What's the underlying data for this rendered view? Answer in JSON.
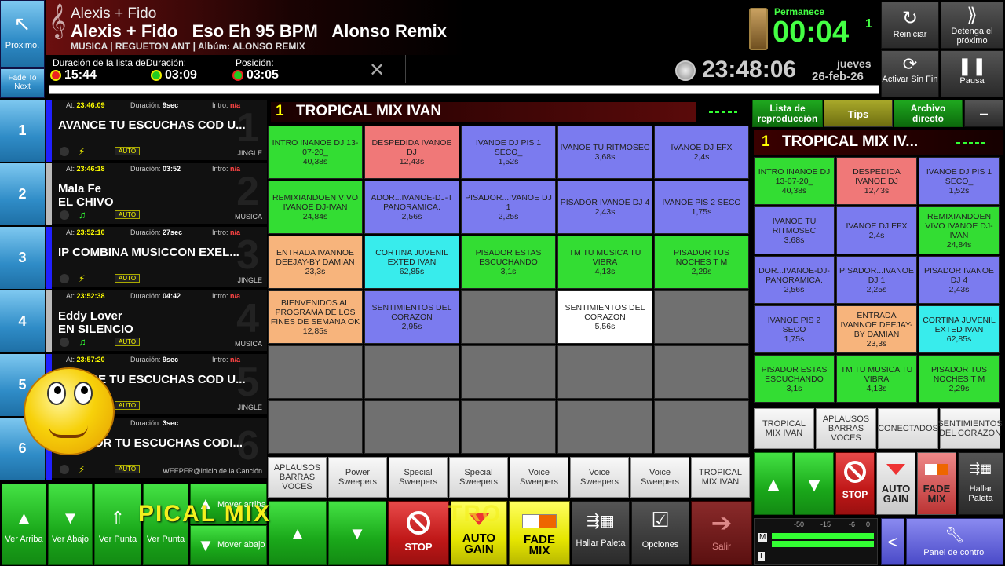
{
  "header": {
    "artist": "Alexis + Fido",
    "song_line": "Alexis + Fido   Eso Eh 95 BPM   Alonso Remix",
    "subtitle": "MUSICA | REGUETON ANT | Albúm: ALONSO REMIX",
    "next_label": "Próximo.",
    "fade_label": "Fade To Next",
    "list_duration_label": "Duración de la lista deDuración:",
    "list_duration_value": "15:44",
    "duration_value": "03:09",
    "position_label": "Posición:",
    "position_value": "03:05",
    "remain_label": "Permanece",
    "remain_value": "00:04",
    "remain_frac": "1",
    "clock": "23:48:06",
    "day": "jueves",
    "date": "26-feb-26",
    "restart_label": "Reiniciar",
    "stop_next_label": "Detenga el próximo",
    "activate_loop_label": "Activar Sin Fin",
    "pause_label": "Pausa"
  },
  "playlist": [
    {
      "num": "1",
      "at_label": "At:",
      "at": "23:46:09",
      "dur_label": "Duración:",
      "dur": "9sec",
      "intro_label": "Intro:",
      "intro": "n/a",
      "title": "AVANCE TU ESCUCHAS COD U...",
      "title2": "",
      "type": "JINGLE",
      "icon": "bolt-icon"
    },
    {
      "num": "2",
      "at_label": "At:",
      "at": "23:46:18",
      "dur_label": "Duración:",
      "dur": "03:52",
      "intro_label": "Intro:",
      "intro": "n/a",
      "title": "Mala Fe",
      "title2": "EL CHIVO",
      "type": "MUSICA",
      "icon": "music-note-icon"
    },
    {
      "num": "3",
      "at_label": "At:",
      "at": "23:52:10",
      "dur_label": "Duración:",
      "dur": "27sec",
      "intro_label": "Intro:",
      "intro": "n/a",
      "title": "IP COMBINA MUSICCON EXEL...",
      "title2": "",
      "type": "JINGLE",
      "icon": "bolt-icon"
    },
    {
      "num": "4",
      "at_label": "At:",
      "at": "23:52:38",
      "dur_label": "Duración:",
      "dur": "04:42",
      "intro_label": "Intro:",
      "intro": "n/a",
      "title": "Eddy Lover",
      "title2": "EN SILENCIO",
      "type": "MUSICA",
      "icon": "music-note-icon"
    },
    {
      "num": "5",
      "at_label": "At:",
      "at": "23:57:20",
      "dur_label": "Duración:",
      "dur": "9sec",
      "intro_label": "Intro:",
      "intro": "n/a",
      "title": "AVANCE TU ESCUCHAS COD U...",
      "title2": "",
      "type": "JINGLE",
      "icon": "bolt-icon"
    },
    {
      "num": "6",
      "at_label": "",
      "at": "",
      "dur_label": "Duración:",
      "dur": "3sec",
      "intro_label": "",
      "intro": "",
      "title": "PISADOR TU ESCUCHAS CODI...",
      "title2": "",
      "type": "WEEPER@Inicio de la Canción",
      "icon": "bolt-icon"
    }
  ],
  "auto_label": "AUTO",
  "center": {
    "number": "1",
    "title": "TROPICAL MIX IVAN",
    "cells": [
      {
        "text": "INTRO INANOE DJ 13-07-20_",
        "time": "40,38s",
        "color": "green"
      },
      {
        "text": "DESPEDIDA IVANOE DJ",
        "time": "12,43s",
        "color": "red"
      },
      {
        "text": "IVANOE DJ PIS 1 SECO_",
        "time": "1,52s",
        "color": "purple"
      },
      {
        "text": "IVANOE TU RITMOSEC",
        "time": "3,68s",
        "color": "purple"
      },
      {
        "text": "IVANOE DJ EFX",
        "time": "2,4s",
        "color": "purple"
      },
      {
        "text": "REMIXIANDOEN VIVO IVANOE DJ-IVAN",
        "time": "24,84s",
        "color": "green"
      },
      {
        "text": "ADOR...IVANOE-DJ-T PANORAMICA.",
        "time": "2,56s",
        "color": "purple"
      },
      {
        "text": "PISADOR...IVANOE DJ  1",
        "time": "2,25s",
        "color": "purple"
      },
      {
        "text": "PISADOR IVANOE DJ 4",
        "time": "2,43s",
        "color": "purple"
      },
      {
        "text": "IVANOE PIS 2 SECO",
        "time": "1,75s",
        "color": "purple"
      },
      {
        "text": "ENTRADA IVANNOE DEEJAY-BY DAMIAN",
        "time": "23,3s",
        "color": "orange"
      },
      {
        "text": "CORTINA JUVENIL EXTED IVAN",
        "time": "62,85s",
        "color": "cyan"
      },
      {
        "text": "PISADOR ESTAS ESCUCHANDO",
        "time": "3,1s",
        "color": "green"
      },
      {
        "text": "TM TU MUSICA TU VIBRA",
        "time": "4,13s",
        "color": "green"
      },
      {
        "text": "PISADOR TUS NOCHES T M",
        "time": "2,29s",
        "color": "green"
      },
      {
        "text": "BIENVENIDOS AL PROGRAMA DE LOS FINES DE SEMANA OK",
        "time": "12,85s",
        "color": "orange"
      },
      {
        "text": "SENTIMIENTOS DEL CORAZON",
        "time": "2,95s",
        "color": "purple"
      },
      {
        "text": "",
        "time": "",
        "color": "empty"
      },
      {
        "text": "SENTIMIENTOS DEL CORAZON",
        "time": "5,56s",
        "color": "white"
      },
      {
        "text": "",
        "time": "",
        "color": "empty"
      },
      {
        "text": "",
        "time": "",
        "color": "empty"
      },
      {
        "text": "",
        "time": "",
        "color": "empty"
      },
      {
        "text": "",
        "time": "",
        "color": "empty"
      },
      {
        "text": "",
        "time": "",
        "color": "empty"
      },
      {
        "text": "",
        "time": "",
        "color": "empty"
      },
      {
        "text": "",
        "time": "",
        "color": "empty"
      },
      {
        "text": "",
        "time": "",
        "color": "empty"
      },
      {
        "text": "",
        "time": "",
        "color": "empty"
      },
      {
        "text": "",
        "time": "",
        "color": "empty"
      },
      {
        "text": "",
        "time": "",
        "color": "empty"
      }
    ],
    "tabs": [
      "APLAUSOS BARRAS VOCES",
      "Power Sweepers",
      "Special Sweepers",
      "Special Sweepers",
      "Voice Sweepers",
      "Voice Sweepers",
      "Voice Sweepers",
      "TROPICAL MIX IVAN"
    ]
  },
  "right": {
    "tab_playlist": "Lista de reproducción",
    "tab_tips": "Tips",
    "tab_direct": "Archivo directo",
    "minus": "–",
    "number": "1",
    "title": "TROPICAL MIX IV...",
    "cells": [
      {
        "text": "INTRO INANOE DJ 13-07-20_",
        "time": "40,38s",
        "color": "green"
      },
      {
        "text": "DESPEDIDA IVANOE DJ",
        "time": "12,43s",
        "color": "red"
      },
      {
        "text": "IVANOE DJ PIS 1 SECO_",
        "time": "1,52s",
        "color": "purple"
      },
      {
        "text": "IVANOE TU RITMOSEC",
        "time": "3,68s",
        "color": "purple"
      },
      {
        "text": "IVANOE DJ EFX",
        "time": "2,4s",
        "color": "purple"
      },
      {
        "text": "REMIXIANDOEN VIVO IVANOE DJ-IVAN",
        "time": "24,84s",
        "color": "green"
      },
      {
        "text": "DOR...IVANOE-DJ- PANORAMICA.",
        "time": "2,56s",
        "color": "purple"
      },
      {
        "text": "PISADOR...IVANOE DJ  1",
        "time": "2,25s",
        "color": "purple"
      },
      {
        "text": "PISADOR IVANOE DJ 4",
        "time": "2,43s",
        "color": "purple"
      },
      {
        "text": "IVANOE PIS 2 SECO",
        "time": "1,75s",
        "color": "purple"
      },
      {
        "text": "ENTRADA IVANNOE DEEJAY-BY DAMIAN",
        "time": "23,3s",
        "color": "orange"
      },
      {
        "text": "CORTINA JUVENIL EXTED IVAN",
        "time": "62,85s",
        "color": "cyan"
      },
      {
        "text": "PISADOR ESTAS ESCUCHANDO",
        "time": "3,1s",
        "color": "green"
      },
      {
        "text": "TM TU MUSICA TU VIBRA",
        "time": "4,13s",
        "color": "green"
      },
      {
        "text": "PISADOR TUS NOCHES T M",
        "time": "2,29s",
        "color": "green"
      }
    ],
    "tabs": [
      "TROPICAL MIX IVAN",
      "APLAUSOS BARRAS VOCES",
      "CONECTADOS",
      "SENTIMIENTOS DEL CORAZON"
    ],
    "stop": "STOP",
    "auto": "AUTO",
    "gain": "GAIN",
    "fade": "FADE",
    "mix": "MIX",
    "find_palette": "Hallar Paleta",
    "meter_ticks": [
      "-50",
      "-15",
      "-6",
      "0"
    ],
    "meter_m": "M",
    "meter_i": "I",
    "back": "<",
    "control_panel": "Panel de control"
  },
  "bottom": {
    "ver_arriba": "Ver Arriba",
    "ver_abajo": "Ver Abajo",
    "ver_punta": "Ver Punta",
    "ver_punta2": "Ver Punta",
    "mover_arriba": "Mover arriba",
    "mover_abajo": "Mover abajo",
    "overlay1": "PICAL MIX",
    "overlay2": "TRO",
    "stop": "STOP",
    "auto": "AUTO",
    "gain": "GAIN",
    "fade": "FADE",
    "mix": "MIX",
    "find_palette": "Hallar Paleta",
    "options": "Opciones",
    "exit": "Salir"
  },
  "colors": {
    "green": "#33dd33",
    "red": "#f07878",
    "purple": "#7b7bef",
    "orange": "#f7b47c",
    "cyan": "#38ecec",
    "white": "#ffffff",
    "empty": "#707070"
  }
}
